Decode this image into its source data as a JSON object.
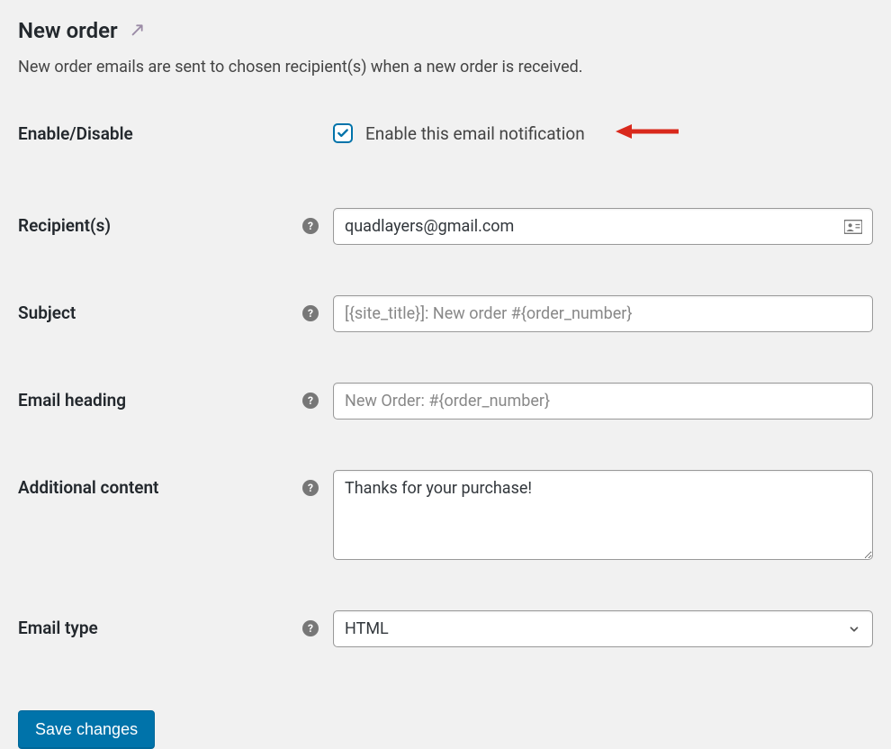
{
  "header": {
    "title": "New order",
    "description": "New order emails are sent to chosen recipient(s) when a new order is received."
  },
  "fields": {
    "enable": {
      "label": "Enable/Disable",
      "checkbox_label": "Enable this email notification",
      "checked": true
    },
    "recipients": {
      "label": "Recipient(s)",
      "value": "quadlayers@gmail.com",
      "placeholder": ""
    },
    "subject": {
      "label": "Subject",
      "value": "",
      "placeholder": "[{site_title}]: New order #{order_number}"
    },
    "email_heading": {
      "label": "Email heading",
      "value": "",
      "placeholder": "New Order: #{order_number}"
    },
    "additional_content": {
      "label": "Additional content",
      "value": "Thanks for your purchase!",
      "placeholder": ""
    },
    "email_type": {
      "label": "Email type",
      "value": "HTML"
    }
  },
  "buttons": {
    "save": "Save changes"
  }
}
